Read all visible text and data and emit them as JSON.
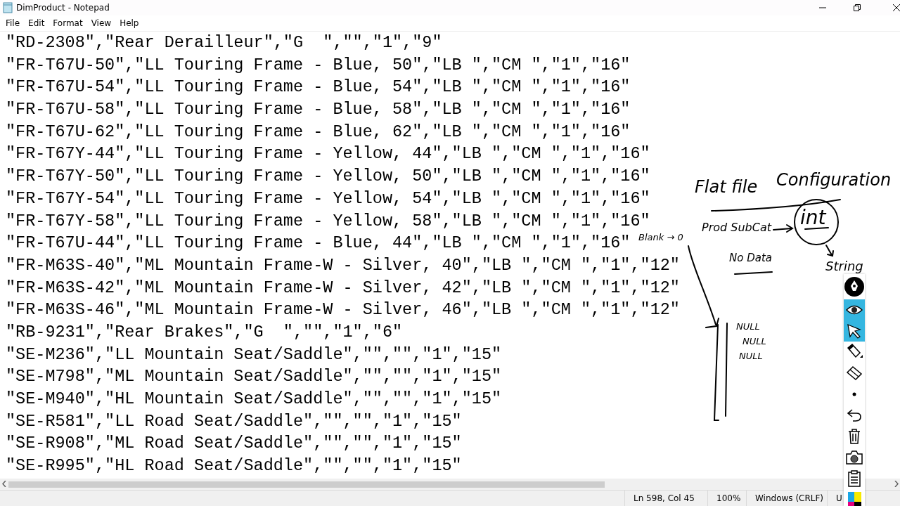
{
  "window": {
    "title": "DimProduct - Notepad"
  },
  "menu": [
    "File",
    "Edit",
    "Format",
    "View",
    "Help"
  ],
  "lines": [
    "\"RD-2308\",\"Rear Derailleur\",\"G  \",\"\",\"1\",\"9\"",
    "\"FR-T67U-50\",\"LL Touring Frame - Blue, 50\",\"LB \",\"CM \",\"1\",\"16\"",
    "\"FR-T67U-54\",\"LL Touring Frame - Blue, 54\",\"LB \",\"CM \",\"1\",\"16\"",
    "\"FR-T67U-58\",\"LL Touring Frame - Blue, 58\",\"LB \",\"CM \",\"1\",\"16\"",
    "\"FR-T67U-62\",\"LL Touring Frame - Blue, 62\",\"LB \",\"CM \",\"1\",\"16\"",
    "\"FR-T67Y-44\",\"LL Touring Frame - Yellow, 44\",\"LB \",\"CM \",\"1\",\"16\"",
    "\"FR-T67Y-50\",\"LL Touring Frame - Yellow, 50\",\"LB \",\"CM \",\"1\",\"16\"",
    "\"FR-T67Y-54\",\"LL Touring Frame - Yellow, 54\",\"LB \",\"CM \",\"1\",\"16\"",
    "\"FR-T67Y-58\",\"LL Touring Frame - Yellow, 58\",\"LB \",\"CM \",\"1\",\"16\"",
    "\"FR-T67U-44\",\"LL Touring Frame - Blue, 44\",\"LB \",\"CM \",\"1\",\"16\"",
    "\"FR-M63S-40\",\"ML Mountain Frame-W - Silver, 40\",\"LB \",\"CM \",\"1\",\"12\"",
    "\"FR-M63S-42\",\"ML Mountain Frame-W - Silver, 42\",\"LB \",\"CM \",\"1\",\"12\"",
    "\"FR-M63S-46\",\"ML Mountain Frame-W - Silver, 46\",\"LB \",\"CM \",\"1\",\"12\"",
    "\"RB-9231\",\"Rear Brakes\",\"G  \",\"\",\"1\",\"6\"",
    "\"SE-M236\",\"LL Mountain Seat/Saddle\",\"\",\"\",\"1\",\"15\"",
    "\"SE-M798\",\"ML Mountain Seat/Saddle\",\"\",\"\",\"1\",\"15\"",
    "\"SE-M940\",\"HL Mountain Seat/Saddle\",\"\",\"\",\"1\",\"15\"",
    "\"SE-R581\",\"LL Road Seat/Saddle\",\"\",\"\",\"1\",\"15\"",
    "\"SE-R908\",\"ML Road Seat/Saddle\",\"\",\"\",\"1\",\"15\"",
    "\"SE-R995\",\"HL Road Seat/Saddle\",\"\",\"\",\"1\",\"15\""
  ],
  "annotations": [
    "Flat file",
    "Configuration",
    "Prod SubCat",
    "int",
    "String",
    "No Data",
    "Blank → 0",
    "NULL",
    "NULL",
    "NULL"
  ],
  "pen_toolbar": [
    {
      "kind": "pen",
      "selected": false
    },
    {
      "kind": "eye",
      "selected": true
    },
    {
      "kind": "pointer",
      "selected": true
    },
    {
      "kind": "pencil",
      "selected": false
    },
    {
      "kind": "eraser",
      "selected": false
    },
    {
      "kind": "dot",
      "selected": false
    },
    {
      "kind": "undo",
      "selected": false
    },
    {
      "kind": "trash",
      "selected": false
    },
    {
      "kind": "camera",
      "selected": false
    },
    {
      "kind": "clipboard",
      "selected": false
    },
    {
      "kind": "palette",
      "selected": false
    }
  ],
  "status_bar": {
    "position": "Ln 598, Col 45",
    "zoom": "100%",
    "line_ending": "Windows (CRLF)",
    "encoding": "U"
  }
}
